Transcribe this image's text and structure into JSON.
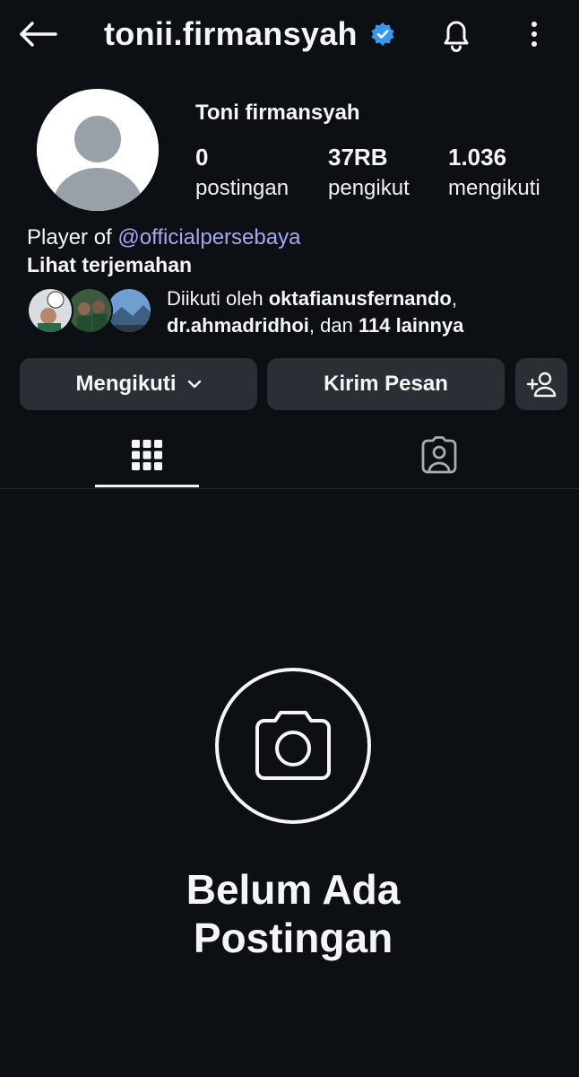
{
  "header": {
    "username": "tonii.firmansyah",
    "verified": true,
    "accent_color": "#3897f0"
  },
  "profile": {
    "display_name": "Toni firmansyah",
    "stats": [
      {
        "value": "0",
        "label": "postingan"
      },
      {
        "value": "37RB",
        "label": "pengikut"
      },
      {
        "value": "1.036",
        "label": "mengikuti"
      }
    ],
    "bio_prefix": "Player of ",
    "bio_mention": "@officialpersebaya",
    "translate_link": "Lihat terjemahan",
    "mutuals": {
      "prefix": "Diikuti oleh ",
      "user1": "oktafianusfernando",
      "sep1": ",",
      "user2": "dr.ahmadridhoi",
      "mid": ", dan ",
      "others": "114 lainnya"
    }
  },
  "actions": {
    "follow_label": "Mengikuti",
    "message_label": "Kirim Pesan"
  },
  "tabs": [
    {
      "icon": "grid-icon",
      "active": true
    },
    {
      "icon": "tagged-icon",
      "active": false
    }
  ],
  "empty_state": {
    "title_line1": "Belum Ada",
    "title_line2": "Postingan"
  }
}
